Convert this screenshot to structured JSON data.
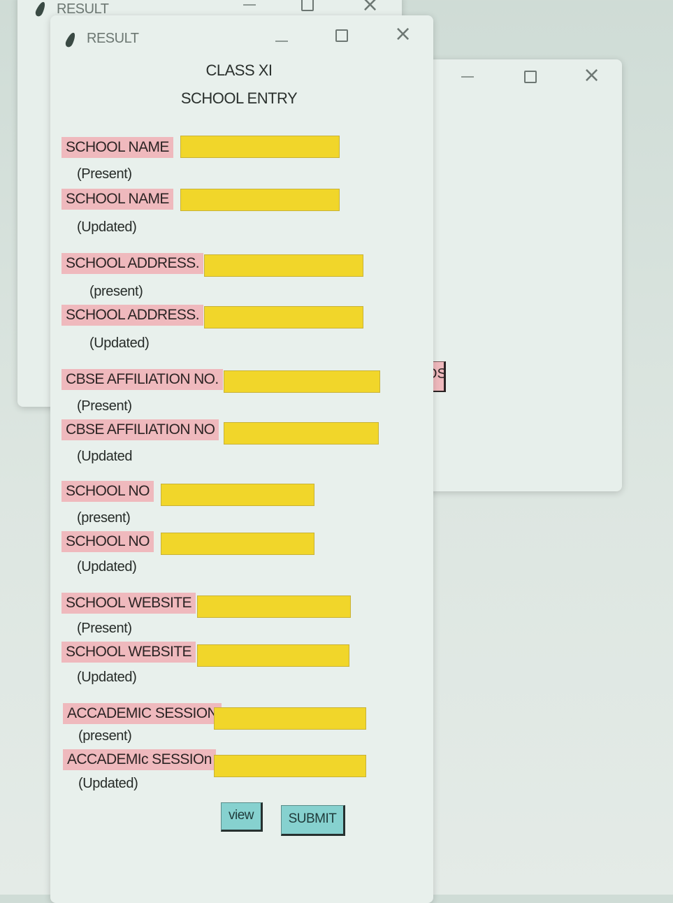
{
  "windows": {
    "back_title": "RESULT",
    "main_title": "RESULT"
  },
  "form": {
    "heading": "CLASS XI",
    "subheading": "SCHOOL ENTRY",
    "fields": [
      {
        "label": "SCHOOL NAME",
        "note": "(Present)",
        "value": ""
      },
      {
        "label": "SCHOOL NAME",
        "note": "(Updated)",
        "value": ""
      },
      {
        "label": "SCHOOL ADDRESS.",
        "note": "(present)",
        "value": ""
      },
      {
        "label": "SCHOOL ADDRESS.",
        "note": "(Updated)",
        "value": ""
      },
      {
        "label": "CBSE AFFILIATION NO.",
        "note": "(Present)",
        "value": ""
      },
      {
        "label": "CBSE AFFILIATION NO",
        "note": "(Updated",
        "value": ""
      },
      {
        "label": "SCHOOL NO",
        "note": "(present)",
        "value": ""
      },
      {
        "label": "SCHOOL NO",
        "note": "(Updated)",
        "value": ""
      },
      {
        "label": "SCHOOL WEBSITE",
        "note": "(Present)",
        "value": ""
      },
      {
        "label": "SCHOOL WEBSITE",
        "note": "(Updated)",
        "value": ""
      },
      {
        "label": "ACCADEMIC SESSION",
        "note": "(present)",
        "value": ""
      },
      {
        "label": "ACCADEMIc SESSIOn",
        "note": "(Updated)",
        "value": ""
      }
    ],
    "view_label": "view",
    "submit_label": "SUBMIT"
  },
  "background_button_partial": "DS",
  "colors": {
    "label_bg": "#efb9bd",
    "entry_bg": "#f1d62a",
    "button_bg": "#86d1cf",
    "window_bg": "#e8f0ec"
  },
  "icons": [
    "feather-icon",
    "minimize-icon",
    "maximize-icon",
    "close-icon"
  ]
}
